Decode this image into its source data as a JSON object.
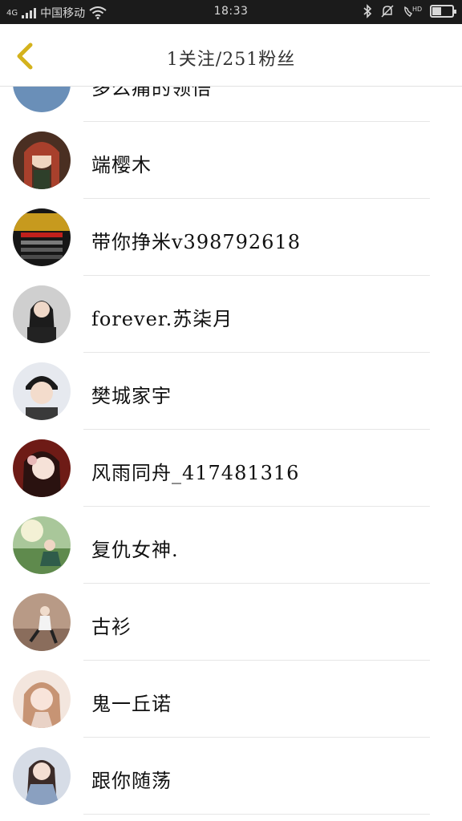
{
  "status_bar": {
    "carrier": "中国移动",
    "network": "4G",
    "time": "18:33",
    "battery_level": 0.45
  },
  "header": {
    "title": "1关注/251粉丝"
  },
  "followers": [
    {
      "name": "多么痛的领悟"
    },
    {
      "name": "端樱木"
    },
    {
      "name": "带你挣米v398792618"
    },
    {
      "name": "forever.苏柒月"
    },
    {
      "name": "樊城家宇"
    },
    {
      "name": "风雨同舟_417481316"
    },
    {
      "name": "复仇女神."
    },
    {
      "name": "古衫"
    },
    {
      "name": "鬼一丘诺"
    },
    {
      "name": "跟你随荡"
    }
  ],
  "colors": {
    "accent_back": "#d4b21c",
    "status_bar_bg": "#1b1b1b",
    "divider": "#e6e6e6"
  }
}
